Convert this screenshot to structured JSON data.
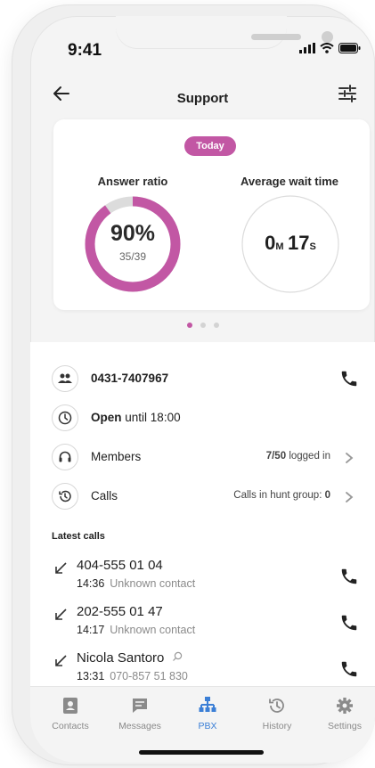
{
  "status_bar": {
    "time": "9:41"
  },
  "header": {
    "title": "Support",
    "back_icon": "arrow-left-icon",
    "filter_icon": "tune-icon"
  },
  "stats": {
    "badge": "Today",
    "answer_ratio": {
      "label": "Answer ratio",
      "percent_text": "90%",
      "fraction_text": "35/39",
      "fill": 0.9,
      "color": "#c257a4",
      "track_color": "#dcdcdc"
    },
    "wait_time": {
      "label": "Average wait time",
      "minutes": "0",
      "minutes_unit": "M",
      "seconds": "17",
      "seconds_unit": "S"
    },
    "page_dots": {
      "count": 3,
      "active": 0
    }
  },
  "group": {
    "number": "0431-7407967",
    "hours": {
      "bold": "Open",
      "text": "until 18:00"
    },
    "members": {
      "label": "Members",
      "count": "7/50",
      "suffix": "logged in"
    },
    "calls": {
      "label": "Calls",
      "hunt_label": "Calls in hunt group:",
      "hunt_count": "0"
    }
  },
  "latest_calls": {
    "title": "Latest calls",
    "items": [
      {
        "name": "404-555 01 04",
        "time": "14:36",
        "detail": "Unknown contact"
      },
      {
        "name": "202-555 01 47",
        "time": "14:17",
        "detail": "Unknown contact"
      },
      {
        "name": "Nicola Santoro",
        "time": "13:31",
        "detail": "070-857 51 830"
      }
    ]
  },
  "tabs": [
    {
      "label": "Contacts",
      "icon": "contacts-icon"
    },
    {
      "label": "Messages",
      "icon": "message-icon"
    },
    {
      "label": "PBX",
      "icon": "pbx-hierarchy-icon",
      "active": true
    },
    {
      "label": "History",
      "icon": "history-icon"
    },
    {
      "label": "Settings",
      "icon": "gear-icon"
    }
  ],
  "colors": {
    "accent": "#c257a4",
    "tab_active": "#3b7fd6"
  }
}
